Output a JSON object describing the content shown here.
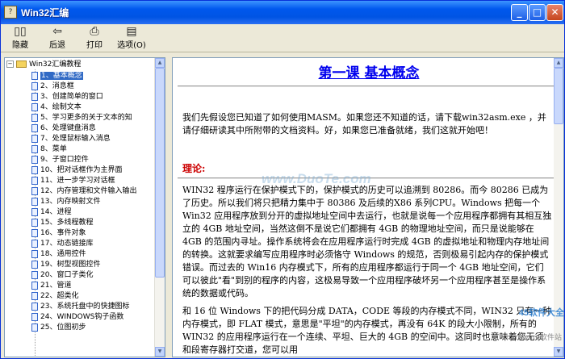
{
  "window": {
    "title": "Win32汇编"
  },
  "toolbar": {
    "hide": "隐藏",
    "back": "后退",
    "print": "打印",
    "options": "选项(O)"
  },
  "tree": {
    "root": "Win32汇编教程",
    "items": [
      "1、基本概念",
      "2、消息框",
      "3、创建简单的窗口",
      "4、绘制文本",
      "5、学习更多的关于文本的知",
      "6、处理键盘消息",
      "7、处理鼠标输入消息",
      "8、菜单",
      "9、子窗口控件",
      "10、把对话框作为主界面",
      "11、进一步学习对话框",
      "12、内存管理和文件输入输出",
      "13、内存映射文件",
      "14、进程",
      "15、多线程教程",
      "16、事件对象",
      "17、动态链接库",
      "18、通用控件",
      "19、树型视图控件",
      "20、窗口子类化",
      "21、管道",
      "22、超类化",
      "23、系统托盘中的快捷图标",
      "24、WINDOWS钩子函数",
      "25、位图初步"
    ]
  },
  "content": {
    "heading": "第一课  基本概念",
    "intro": "我们先假设您已知道了如何使用MASM。如果您还不知道的话，请下载win32asm.exe ，并请仔细研读其中所附带的文档资料。好，如果您已准备就绪，我们这就开始吧！",
    "section": "理论:",
    "p1": "WIN32 程序运行在保护模式下的，保护模式的历史可以追溯到 80286。而今 80286 已成为了历史。所以我们将只把精力集中于 80386 及后续的X86 系列CPU。Windows 把每一个 Win32 应用程序放到分开的虚拟地址空间中去运行，也就是说每一个应用程序都拥有其相互独立的 4GB 地址空间，当然这倒不是说它们都拥有 4GB 的物理地址空间，而只是说能够在 4GB 的范围内寻址。操作系统将会在应用程序运行时完成 4GB 的虚拟地址和物理内存地址间的转换。这就要求编写应用程序时必须恪守 Windows 的规范，否则极易引起内存的保护模式错误。而过去的 Win16 内存模式下，所有的应用程序都运行于同一个 4GB 地址空间，它们可以彼此\"看\"到别的程序的内容，这极易导致一个应用程序破坏另一个应用程序甚至是操作系统的数据或代码。",
    "p2": "和 16 位 Windows 下的把代码分成 DATA，CODE 等段的内存模式不同，WIN32 只有一种内存模式，即 FLAT 模式，意思是\"平坦\"的内存模式，再没有 64K 的段大小限制，所有的 WIN32 的应用程序运行在一个连续、平坦、巨大的 4GB 的空间中。这同时也意味着您无须和段寄存器打交道，您可以用"
  },
  "watermark": "www.DuoTe.com",
  "badge": {
    "name": "45软件大全",
    "sub": "shareware软件站"
  }
}
